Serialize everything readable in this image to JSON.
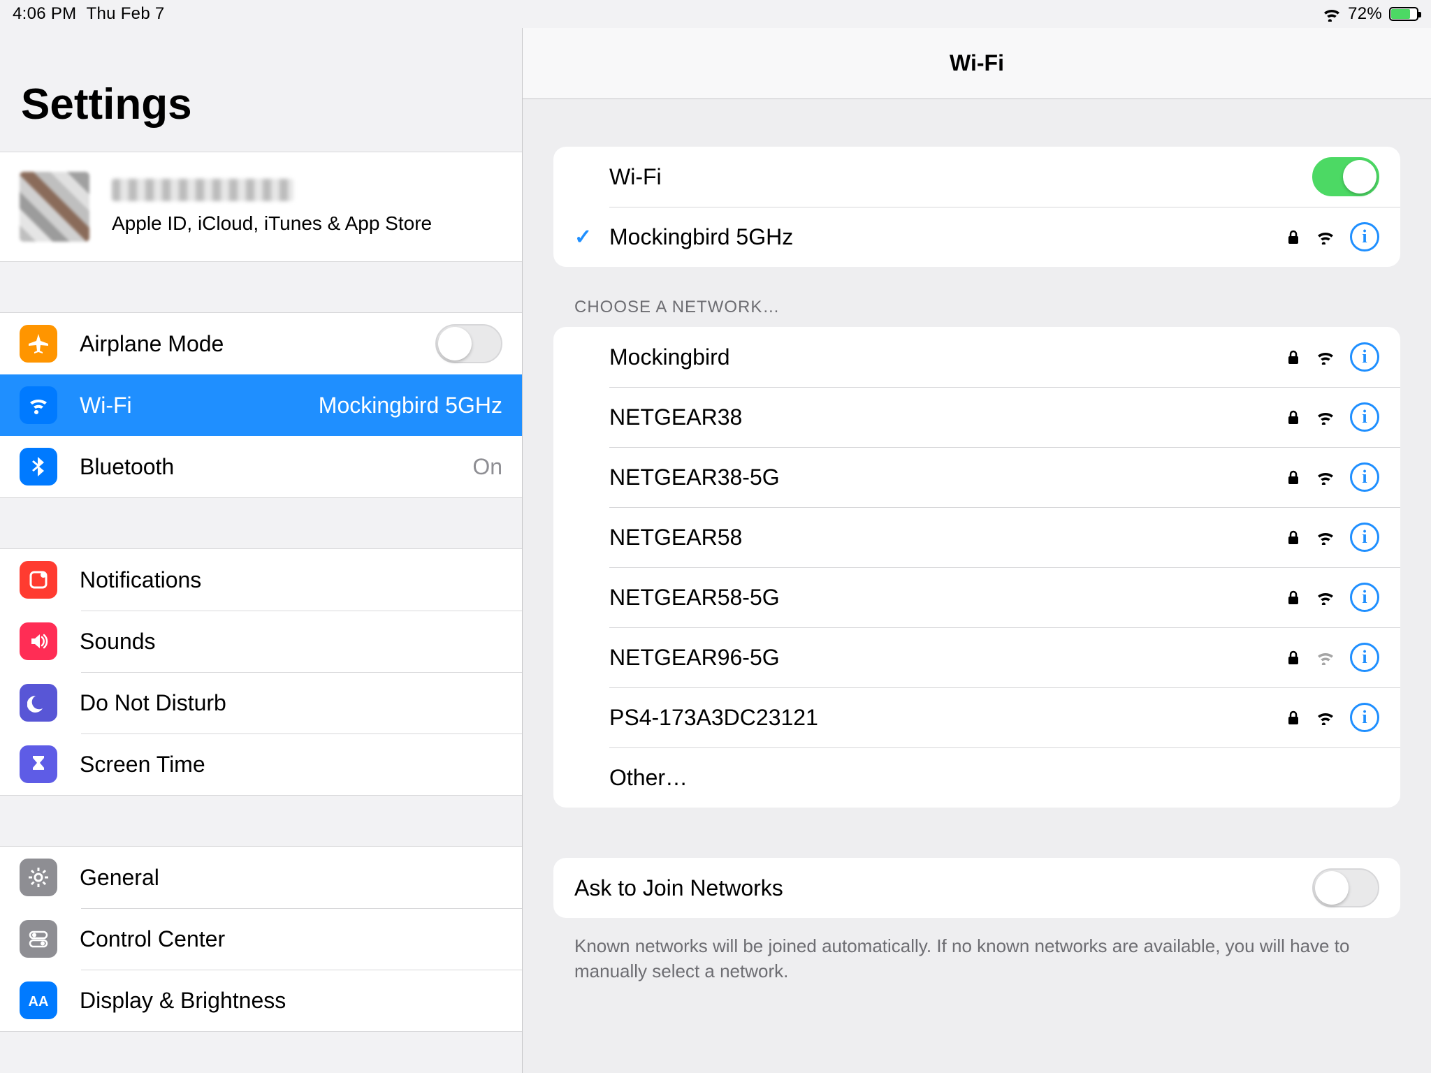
{
  "status": {
    "time": "4:06 PM",
    "date": "Thu Feb 7",
    "battery_pct": "72%",
    "battery_fill": 72
  },
  "sidebar": {
    "title": "Settings",
    "account_subtitle": "Apple ID, iCloud, iTunes & App Store",
    "items": {
      "airplane": {
        "label": "Airplane Mode"
      },
      "wifi": {
        "label": "Wi-Fi",
        "value": "Mockingbird 5GHz"
      },
      "bluetooth": {
        "label": "Bluetooth",
        "value": "On"
      },
      "notifications": {
        "label": "Notifications"
      },
      "sounds": {
        "label": "Sounds"
      },
      "dnd": {
        "label": "Do Not Disturb"
      },
      "screentime": {
        "label": "Screen Time"
      },
      "general": {
        "label": "General"
      },
      "controlcenter": {
        "label": "Control Center"
      },
      "display": {
        "label": "Display & Brightness"
      }
    }
  },
  "detail": {
    "title": "Wi-Fi",
    "wifi_label": "Wi-Fi",
    "wifi_on": true,
    "connected": {
      "name": "Mockingbird 5GHz",
      "locked": true,
      "strength": 3
    },
    "choose_header": "Choose a Network…",
    "networks": [
      {
        "name": "Mockingbird",
        "locked": true,
        "strength": 3
      },
      {
        "name": "NETGEAR38",
        "locked": true,
        "strength": 3
      },
      {
        "name": "NETGEAR38-5G",
        "locked": true,
        "strength": 3
      },
      {
        "name": "NETGEAR58",
        "locked": true,
        "strength": 3
      },
      {
        "name": "NETGEAR58-5G",
        "locked": true,
        "strength": 3
      },
      {
        "name": "NETGEAR96-5G",
        "locked": true,
        "strength": 1
      },
      {
        "name": "PS4-173A3DC23121",
        "locked": true,
        "strength": 3
      }
    ],
    "other_label": "Other…",
    "ask_label": "Ask to Join Networks",
    "ask_on": false,
    "ask_footer": "Known networks will be joined automatically. If no known networks are available, you will have to manually select a network."
  }
}
